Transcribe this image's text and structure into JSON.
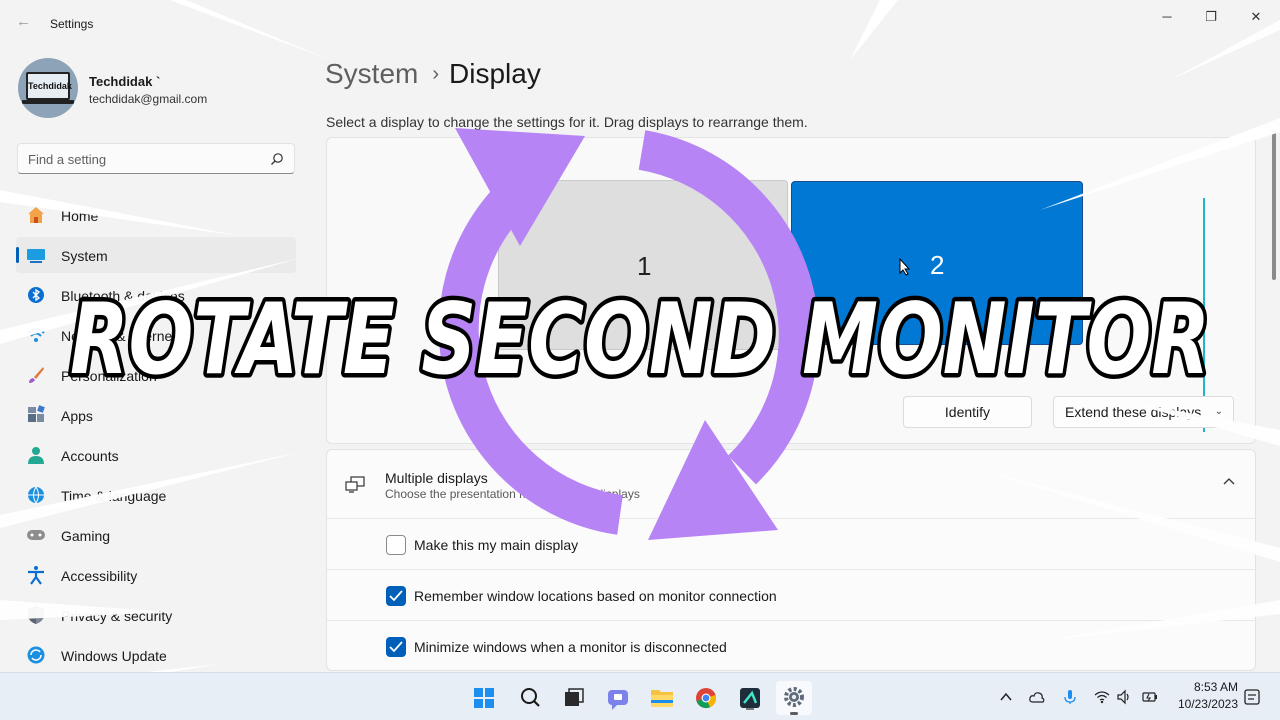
{
  "window": {
    "title": "Settings",
    "controls": {
      "minimize": "─",
      "maximize": "❐",
      "close": "✕"
    }
  },
  "profile": {
    "name": "Techdidak `",
    "email": "techdidak@gmail.com",
    "avatar_text": "Techdidak"
  },
  "search": {
    "placeholder": "Find a setting"
  },
  "sidebar": {
    "items": [
      {
        "label": "Home",
        "icon": "home-icon"
      },
      {
        "label": "System",
        "icon": "system-icon",
        "active": true
      },
      {
        "label": "Bluetooth & devices",
        "icon": "bluetooth-icon"
      },
      {
        "label": "Network & internet",
        "icon": "wifi-icon"
      },
      {
        "label": "Personalization",
        "icon": "brush-icon"
      },
      {
        "label": "Apps",
        "icon": "apps-icon"
      },
      {
        "label": "Accounts",
        "icon": "person-icon"
      },
      {
        "label": "Time & language",
        "icon": "globe-icon"
      },
      {
        "label": "Gaming",
        "icon": "gamepad-icon"
      },
      {
        "label": "Accessibility",
        "icon": "accessibility-icon"
      },
      {
        "label": "Privacy & security",
        "icon": "shield-icon"
      },
      {
        "label": "Windows Update",
        "icon": "update-icon"
      }
    ]
  },
  "breadcrumb": {
    "parent": "System",
    "separator": "›",
    "current": "Display"
  },
  "subtitle": "Select a display to change the settings for it. Drag displays to rearrange them.",
  "monitors": [
    {
      "number": "1"
    },
    {
      "number": "2"
    }
  ],
  "buttons": {
    "identify": "Identify",
    "extend": "Extend these displays"
  },
  "multiple_displays": {
    "title": "Multiple displays",
    "description": "Choose the presentation mode for your displays",
    "options": [
      {
        "label": "Make this my main display",
        "checked": false
      },
      {
        "label": "Remember window locations based on monitor connection",
        "checked": true
      },
      {
        "label": "Minimize windows when a monitor is disconnected",
        "checked": true
      }
    ]
  },
  "overlay": {
    "headline": "ROTATE SECOND MONITOR",
    "arrow_color": "#b784f5"
  },
  "taskbar": {
    "time": "8:53 AM",
    "date": "10/23/2023"
  },
  "colors": {
    "accent": "#005fb8",
    "selected_monitor": "#0078d4"
  }
}
